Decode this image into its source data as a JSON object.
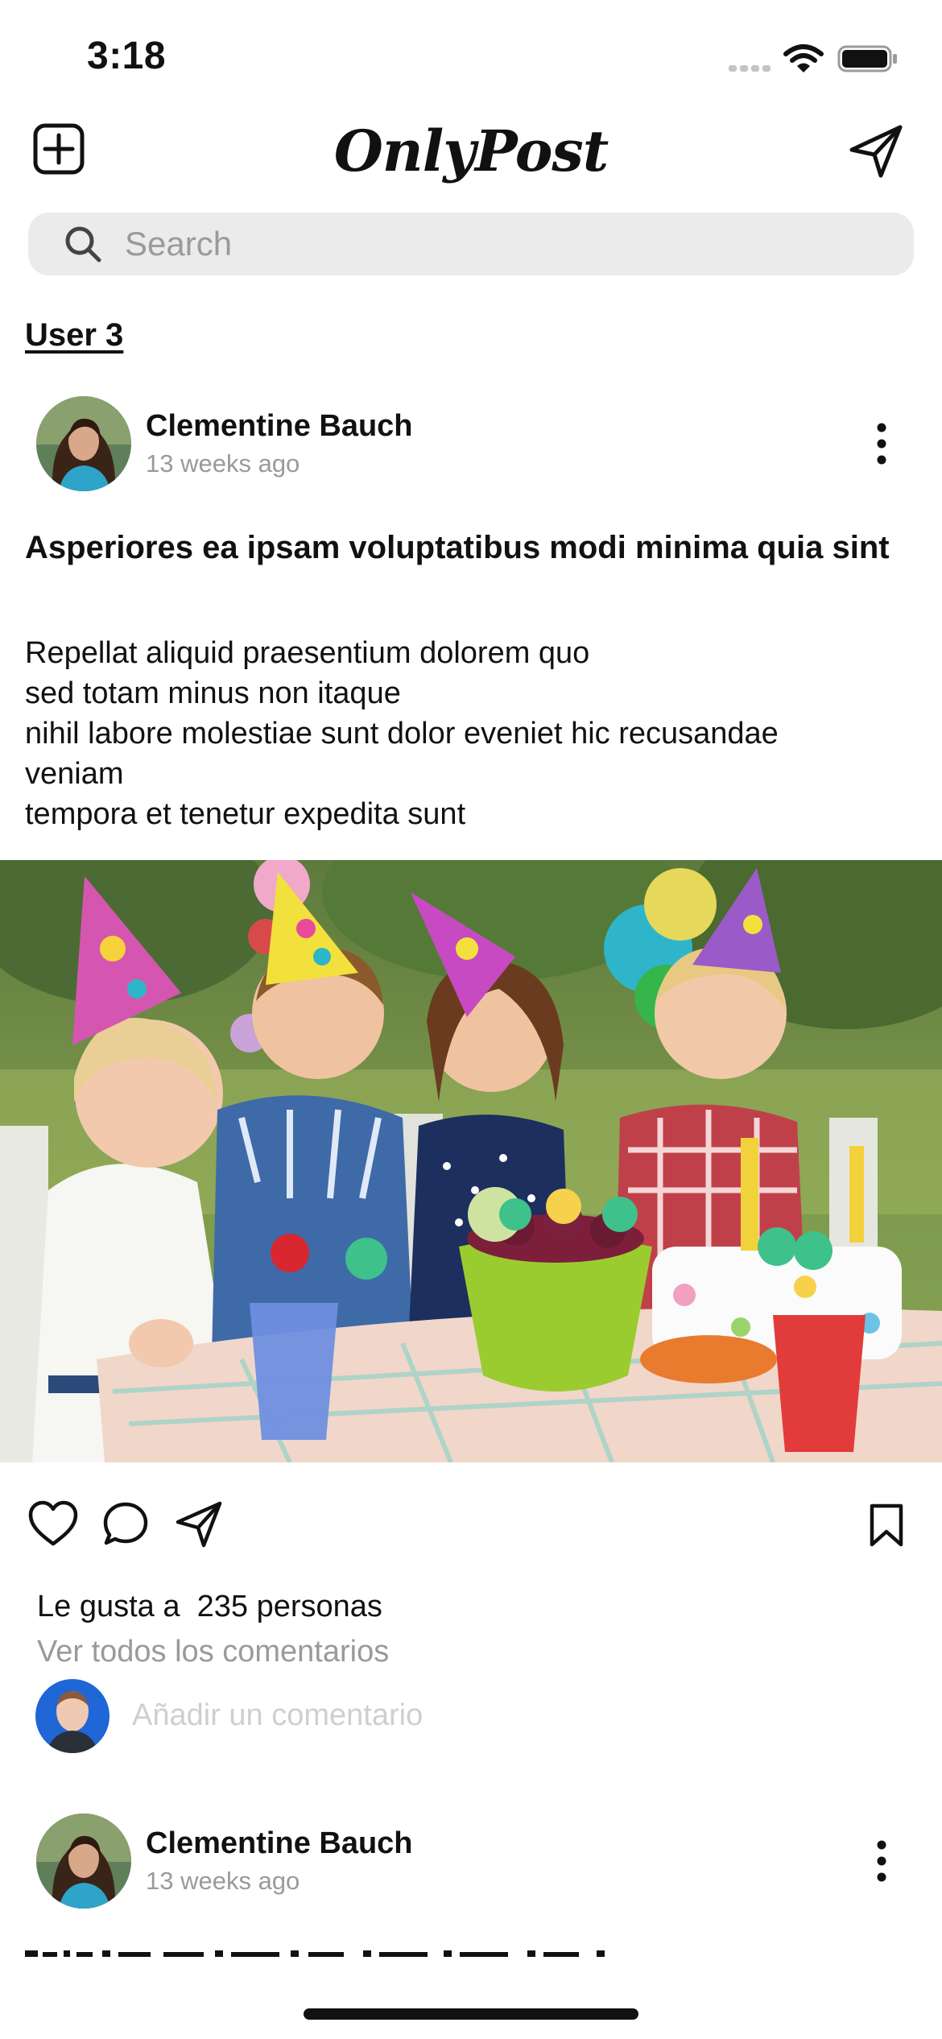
{
  "status_bar": {
    "time": "3:18"
  },
  "header": {
    "logo": "OnlyPost",
    "icons": {
      "left": "plus-square-icon",
      "right": "send-icon"
    }
  },
  "search": {
    "placeholder": "Search",
    "value": ""
  },
  "profile_link": "User 3",
  "posts": [
    {
      "author": "Clementine Bauch",
      "time": "13 weeks ago",
      "title": "Asperiores ea ipsam voluptatibus modi minima quia sint",
      "body_lines": [
        "Repellat aliquid praesentium dolorem quo",
        "sed totam minus non itaque",
        "nihil labore molestiae sunt dolor eveniet hic recusandae",
        "veniam",
        "tempora et tenetur expedita sunt"
      ],
      "likes_prefix": "Le gusta a",
      "likes_count": "235 personas",
      "view_comments": "Ver todos los comentarios",
      "comment_placeholder": "Añadir un comentario"
    },
    {
      "author": "Clementine Bauch",
      "time": "13 weeks ago"
    }
  ],
  "colors": {
    "search_bg": "#ebebeb",
    "muted_text": "#9a9a9a",
    "placeholder_text": "#cfcfcf"
  }
}
